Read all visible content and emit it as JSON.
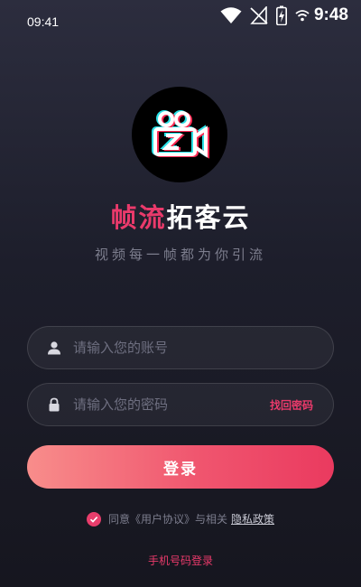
{
  "status_bar": {
    "time_left": "09:41",
    "clock": "9:48"
  },
  "brand": {
    "name_accent": "帧流",
    "name_rest": "拓客云",
    "slogan": "视频每一帧都为你引流"
  },
  "login_form": {
    "account_placeholder": "请输入您的账号",
    "password_placeholder": "请输入您的密码",
    "forgot_password": "找回密码",
    "login_button": "登录"
  },
  "agreement": {
    "checked": true,
    "text": "同意《用户协议》与相关",
    "privacy_link": "隐私政策"
  },
  "alt_login": {
    "phone_login": "手机号码登录"
  },
  "colors": {
    "accent": "#ea3a6b",
    "background_top": "#2c2d3e",
    "background_bottom": "#16161f"
  },
  "icons": {
    "user": "user-icon",
    "lock": "lock-icon",
    "logo": "camera-logo-icon"
  }
}
